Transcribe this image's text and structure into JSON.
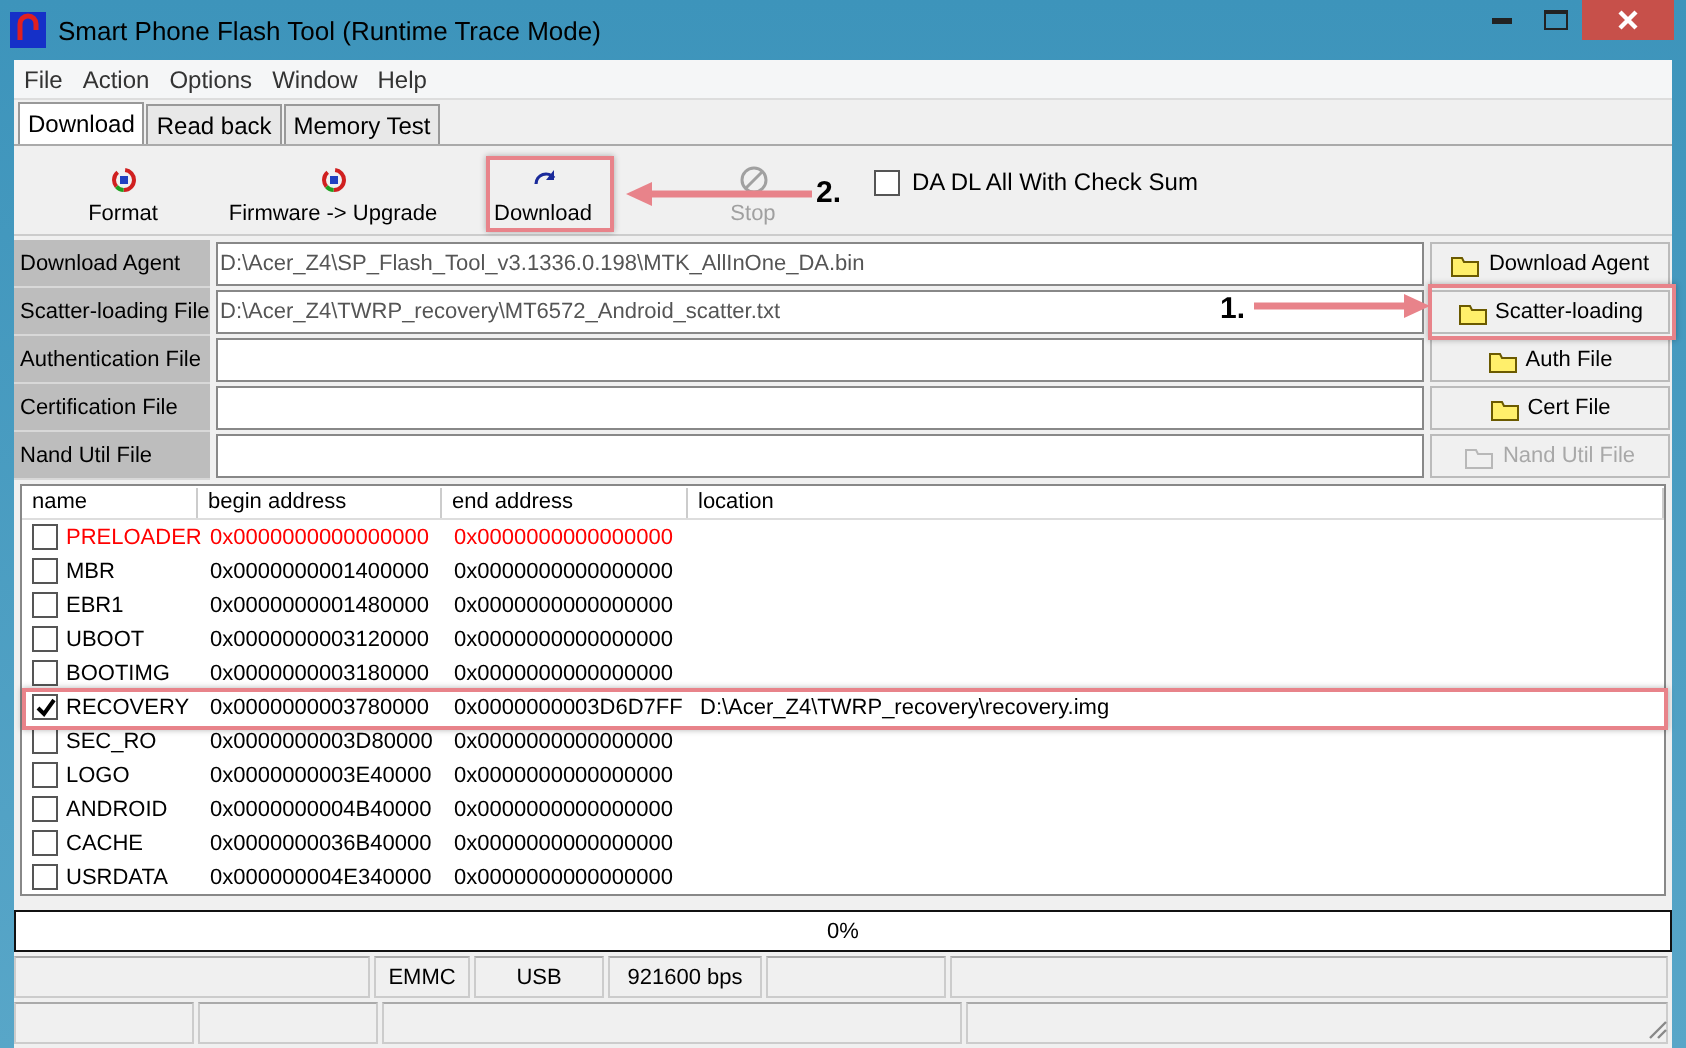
{
  "window": {
    "title": "Smart Phone Flash Tool (Runtime Trace Mode)"
  },
  "menu": [
    "File",
    "Action",
    "Options",
    "Window",
    "Help"
  ],
  "tabs": [
    {
      "label": "Download",
      "selected": true
    },
    {
      "label": "Read back",
      "selected": false
    },
    {
      "label": "Memory Test",
      "selected": false
    }
  ],
  "toolbar": [
    {
      "label": "Format",
      "kind": "format",
      "disabled": false
    },
    {
      "label": "Firmware -> Upgrade",
      "kind": "format",
      "disabled": false
    },
    {
      "label": "Download",
      "kind": "download",
      "disabled": false
    },
    {
      "label": "Stop",
      "kind": "stop",
      "disabled": true
    }
  ],
  "checksum": {
    "label": "DA DL All With Check Sum",
    "checked": false
  },
  "files": [
    {
      "label": "Download Agent",
      "value": "D:\\Acer_Z4\\SP_Flash_Tool_v3.1336.0.198\\MTK_AllInOne_DA.bin",
      "button": "Download Agent",
      "disabled": false
    },
    {
      "label": "Scatter-loading File",
      "value": "D:\\Acer_Z4\\TWRP_recovery\\MT6572_Android_scatter.txt",
      "button": "Scatter-loading",
      "disabled": false
    },
    {
      "label": "Authentication File",
      "button": "Auth File",
      "disabled": false
    },
    {
      "label": "Certification File",
      "button": "Cert File",
      "disabled": false
    },
    {
      "label": "Nand Util File",
      "button": "Nand Util File",
      "disabled": true
    }
  ],
  "table": {
    "columns": [
      "name",
      "begin address",
      "end address",
      "location"
    ],
    "rows": [
      {
        "name": "PRELOADER",
        "begin": "0x0000000000000000",
        "end": "0x0000000000000000",
        "checked": false,
        "color": "#ff0000"
      },
      {
        "name": "MBR",
        "begin": "0x0000000001400000",
        "end": "0x0000000000000000",
        "checked": false,
        "color": "#000000"
      },
      {
        "name": "EBR1",
        "begin": "0x0000000001480000",
        "end": "0x0000000000000000",
        "checked": false,
        "color": "#000000"
      },
      {
        "name": "UBOOT",
        "begin": "0x0000000003120000",
        "end": "0x0000000000000000",
        "checked": false,
        "color": "#000000"
      },
      {
        "name": "BOOTIMG",
        "begin": "0x0000000003180000",
        "end": "0x0000000000000000",
        "checked": false,
        "color": "#000000"
      },
      {
        "name": "RECOVERY",
        "begin": "0x0000000003780000",
        "end": "0x0000000003D6D7FF",
        "location": "D:\\Acer_Z4\\TWRP_recovery\\recovery.img",
        "checked": true,
        "color": "#000000"
      },
      {
        "name": "SEC_RO",
        "begin": "0x0000000003D80000",
        "end": "0x0000000000000000",
        "checked": false,
        "color": "#000000"
      },
      {
        "name": "LOGO",
        "begin": "0x0000000003E40000",
        "end": "0x0000000000000000",
        "checked": false,
        "color": "#000000"
      },
      {
        "name": "ANDROID",
        "begin": "0x0000000004B40000",
        "end": "0x0000000000000000",
        "checked": false,
        "color": "#000000"
      },
      {
        "name": "CACHE",
        "begin": "0x0000000036B40000",
        "end": "0x0000000000000000",
        "checked": false,
        "color": "#000000"
      },
      {
        "name": "USRDATA",
        "begin": "0x000000004E340000",
        "end": "0x0000000000000000",
        "checked": false,
        "color": "#000000"
      }
    ]
  },
  "progress": {
    "level": 0,
    "reading": "0%"
  },
  "status_bar": [
    "EMMC",
    "USB",
    "921600 bps"
  ],
  "annotations": [
    {
      "label": "2."
    },
    {
      "label": "1."
    }
  ]
}
